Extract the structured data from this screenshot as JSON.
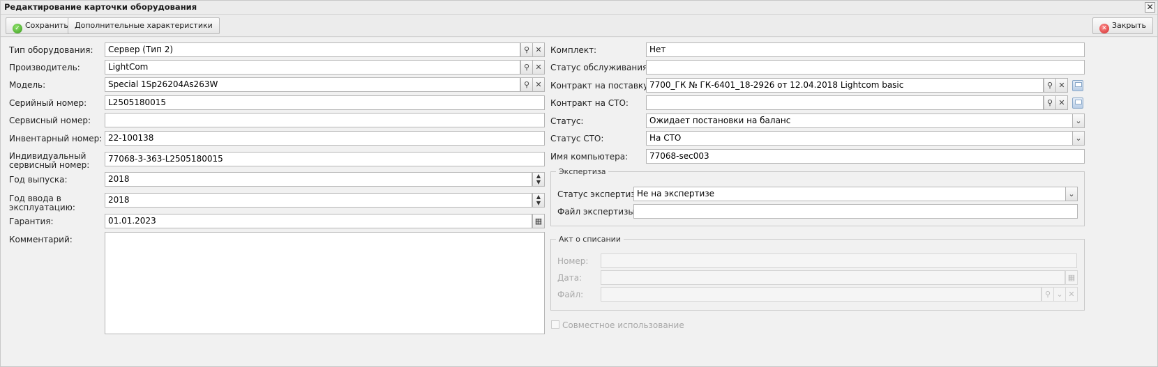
{
  "window": {
    "title": "Редактирование карточки оборудования",
    "close_symbol": "✕"
  },
  "toolbar": {
    "save_label": "Сохранить",
    "extra_label": "Дополнительные характеристики",
    "close_label": "Закрыть"
  },
  "left": {
    "type": {
      "label": "Тип оборудования:",
      "value": "Сервер (Тип 2)"
    },
    "maker": {
      "label": "Производитель:",
      "value": "LightCom"
    },
    "model": {
      "label": "Модель:",
      "value": "Special 1Sp26204As263W"
    },
    "serial": {
      "label": "Серийный номер:",
      "value": "L2505180015"
    },
    "service": {
      "label": "Сервисный номер:",
      "value": ""
    },
    "inventory": {
      "label": "Инвентарный номер:",
      "value": "22-100138"
    },
    "indiv": {
      "label1": "Индивидуальный",
      "label2": "сервисный номер:",
      "value": "77068-3-363-L2505180015"
    },
    "year": {
      "label": "Год выпуска:",
      "value": "2018"
    },
    "commission": {
      "label1": "Год ввода в",
      "label2": "эксплуатацию:",
      "value": "2018"
    },
    "warranty": {
      "label": "Гарантия:",
      "value": "01.01.2023"
    },
    "comment": {
      "label": "Комментарий:",
      "value": ""
    }
  },
  "right": {
    "kit": {
      "label": "Комплект:",
      "value": "Нет"
    },
    "svc_status": {
      "label": "Статус обслуживания:",
      "value": ""
    },
    "contract": {
      "label": "Контракт на поставку:",
      "value": "7700_ГК № ГК-6401_18-2926 от 12.04.2018 Lightcom basic"
    },
    "contract_sto": {
      "label": "Контракт на СТО:",
      "value": ""
    },
    "status": {
      "label": "Статус:",
      "value": "Ожидает постановки на баланс"
    },
    "status_sto": {
      "label": "Статус СТО:",
      "value": "На СТО"
    },
    "pc_name": {
      "label": "Имя компьютера:",
      "value": "77068-sec003"
    }
  },
  "expertise": {
    "legend": "Экспертиза",
    "status": {
      "label": "Статус экспертизы:",
      "value": "Не на экспертизе"
    },
    "file": {
      "label": "Файл экспертизы:",
      "value": ""
    }
  },
  "writeoff": {
    "legend": "Акт о списании",
    "number": {
      "label": "Номер:",
      "value": ""
    },
    "date": {
      "label": "Дата:",
      "value": ""
    },
    "file": {
      "label": "Файл:",
      "value": ""
    }
  },
  "shared": {
    "label": "Совместное использование",
    "checked": false
  },
  "icons": {
    "search": "search-icon",
    "clear": "clear-icon",
    "save_disk": "disk-icon",
    "dropdown": "chevron-down-icon",
    "calendar": "calendar-icon"
  }
}
